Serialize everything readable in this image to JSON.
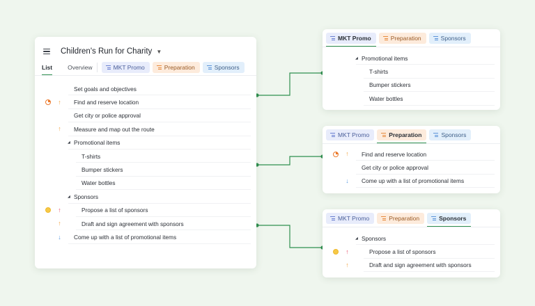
{
  "colors": {
    "background": "#eff6ee",
    "connector": "#2f8f4f",
    "accent_green": "#2f8f4f",
    "chip_blue_bg": "#e8ecfb",
    "chip_orange_bg": "#fdebdc",
    "chip_cyan_bg": "#e2effb"
  },
  "main": {
    "title": "Children's Run for Charity",
    "tabs": [
      {
        "label": "List",
        "active": true
      },
      {
        "label": "Overview",
        "active": false
      }
    ],
    "chips": [
      {
        "label": "MKT Promo",
        "icon": "list-icon",
        "color": "blue"
      },
      {
        "label": "Preparation",
        "icon": "list-icon",
        "color": "orange"
      },
      {
        "label": "Sponsors",
        "icon": "list-icon",
        "color": "cyan"
      }
    ],
    "tasks": [
      {
        "label": "Set goals and objectives",
        "level": 0,
        "status_icon": "",
        "priority_icon": ""
      },
      {
        "label": "Find and reserve location",
        "level": 0,
        "status_icon": "clock-orange-icon",
        "priority_icon": "arrow-up-orange-icon"
      },
      {
        "label": "Get city or police approval",
        "level": 0,
        "status_icon": "",
        "priority_icon": ""
      },
      {
        "label": "Measure and map out the route",
        "level": 0,
        "status_icon": "",
        "priority_icon": "arrow-up-orange-icon"
      },
      {
        "label": "Promotional items",
        "level": 0,
        "collapsible": true,
        "status_icon": "",
        "priority_icon": ""
      },
      {
        "label": "T-shirts",
        "level": 1,
        "status_icon": "",
        "priority_icon": ""
      },
      {
        "label": "Bumper stickers",
        "level": 1,
        "status_icon": "",
        "priority_icon": ""
      },
      {
        "label": "Water bottles",
        "level": 1,
        "status_icon": "",
        "priority_icon": ""
      },
      {
        "label": "Sponsors",
        "level": 0,
        "collapsible": true,
        "status_icon": "",
        "priority_icon": ""
      },
      {
        "label": "Propose a list of sponsors",
        "level": 1,
        "status_icon": "clock-yellow-icon",
        "priority_icon": "arrow-up-red-icon"
      },
      {
        "label": "Draft and sign agreement with sponsors",
        "level": 1,
        "status_icon": "",
        "priority_icon": "arrow-up-orange-icon"
      },
      {
        "label": "Come up with a list of promotional items",
        "level": 0,
        "status_icon": "",
        "priority_icon": "arrow-down-blue-icon"
      }
    ]
  },
  "cards": {
    "mkt": {
      "selected_chip": "MKT Promo",
      "rows": [
        {
          "label": "Promotional items",
          "level": 0,
          "collapsible": true
        },
        {
          "label": "T-shirts",
          "level": 1
        },
        {
          "label": "Bumper stickers",
          "level": 1
        },
        {
          "label": "Water bottles",
          "level": 1
        }
      ]
    },
    "prep": {
      "selected_chip": "Preparation",
      "rows": [
        {
          "label": "Find and reserve location",
          "status_icon": "clock-orange-icon",
          "priority_icon": "arrow-up-orange-icon"
        },
        {
          "label": "Get city or police approval"
        },
        {
          "label": "Come up with a list of promotional items",
          "priority_icon": "arrow-down-blue-icon"
        }
      ]
    },
    "spons": {
      "selected_chip": "Sponsors",
      "rows": [
        {
          "label": "Sponsors",
          "level": 0,
          "collapsible": true
        },
        {
          "label": "Propose a list of sponsors",
          "level": 1,
          "status_icon": "clock-yellow-icon",
          "priority_icon": "arrow-up-red-icon"
        },
        {
          "label": "Draft and sign agreement with sponsors",
          "level": 1,
          "priority_icon": "arrow-up-orange-icon"
        }
      ]
    }
  }
}
